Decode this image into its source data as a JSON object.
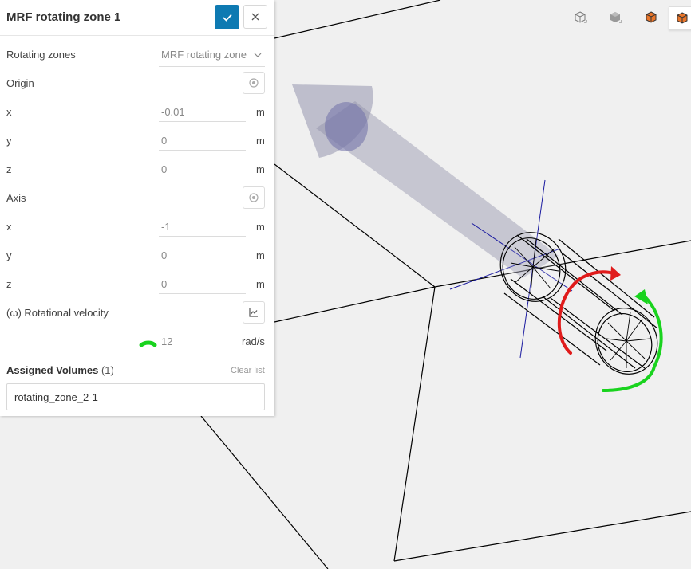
{
  "panel": {
    "title": "MRF rotating zone 1",
    "rotating_zones_label": "Rotating zones",
    "rotating_zones_value": "MRF rotating zone",
    "origin_label": "Origin",
    "origin": {
      "x": "-0.01",
      "y": "0",
      "z": "0"
    },
    "axis_label": "Axis",
    "axis": {
      "x": "-1",
      "y": "0",
      "z": "0"
    },
    "coord_labels": {
      "x": "x",
      "y": "y",
      "z": "z"
    },
    "unit_m": "m",
    "rotational_velocity_label": "(ω) Rotational velocity",
    "rotational_velocity_value": "12",
    "rotational_velocity_unit": "rad/s",
    "assigned_volumes_label": "Assigned Volumes",
    "assigned_volumes_count": "(1)",
    "clear_list_label": "Clear list",
    "assigned_volumes": [
      "rotating_zone_2-1"
    ]
  },
  "colors": {
    "primary": "#0e7ab2",
    "arrow": "#9c9cc4",
    "annotation_red": "#e01b1b",
    "annotation_green": "#19d31e",
    "axis_lines": "#1a1aa0"
  },
  "icons": {
    "confirm": "check-icon",
    "close": "close-icon",
    "dropdown": "chevron-down-icon",
    "pick": "target-icon",
    "table": "chart-icon",
    "views": [
      "cube-outline-icon",
      "cube-shaded-icon",
      "cube-orange-icon",
      "cube-orange-wire-icon"
    ]
  }
}
